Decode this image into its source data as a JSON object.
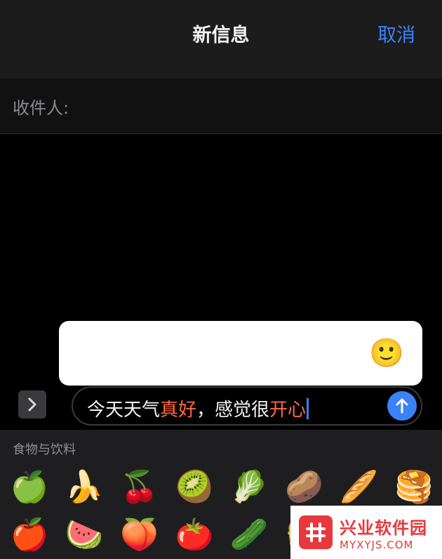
{
  "nav": {
    "title": "新信息",
    "cancel_label": "取消"
  },
  "recipient": {
    "label": "收件人:"
  },
  "suggestions": [
    "😀",
    "😁",
    "😃",
    "😄",
    "😆",
    "😌",
    "🙂"
  ],
  "input": {
    "segments": [
      {
        "text": "今天天气",
        "highlight": false
      },
      {
        "text": "真好",
        "highlight": true
      },
      {
        "text": "，感觉很",
        "highlight": false
      },
      {
        "text": "开心",
        "highlight": true
      }
    ]
  },
  "keyboard": {
    "category": "食物与饮料",
    "row1": [
      "🍏",
      "🍌",
      "🍒",
      "🥝",
      "🥬",
      "🥔",
      "🥖",
      "🥞"
    ],
    "row2": [
      "🍎",
      "🍉",
      "🍑",
      "🍅",
      "🥒",
      "🍔",
      "",
      ""
    ]
  },
  "watermark": {
    "name": "兴业软件园",
    "domain": "MYXYJS.COM"
  },
  "colors": {
    "accent": "#3a82f7",
    "highlight": "#ff6a3d",
    "watermark": "#e8383d"
  }
}
